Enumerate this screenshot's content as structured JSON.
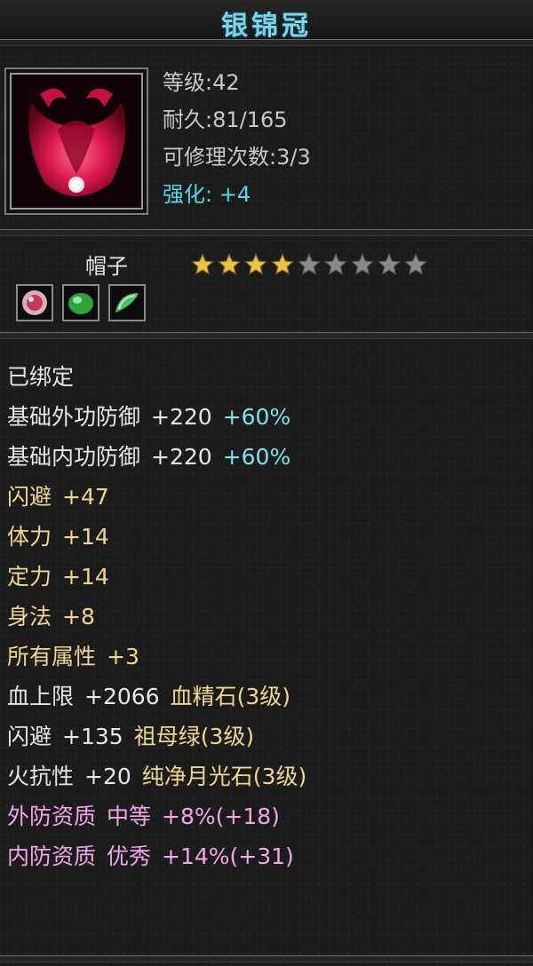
{
  "item": {
    "name": "银锦冠",
    "level": "等级:42",
    "durability": "耐久:81/165",
    "repair_count": "可修理次数:3/3",
    "enhance_label": "强化:",
    "enhance_value": "+4",
    "category": "帽子",
    "stars_filled": 4,
    "stars_total": 9,
    "gems": [
      "blood-essence-gem-icon",
      "emerald-gem-icon",
      "moonstone-gem-icon"
    ]
  },
  "stats": [
    {
      "color": "white",
      "parts": [
        "已绑定"
      ]
    },
    {
      "color": "white",
      "parts": [
        "基础外功防御",
        "+220",
        "+60%"
      ],
      "accent_last": true
    },
    {
      "color": "white",
      "parts": [
        "基础内功防御",
        "+220",
        "+60%"
      ],
      "accent_last": true
    },
    {
      "color": "gold",
      "parts": [
        "闪避",
        "+47"
      ]
    },
    {
      "color": "gold",
      "parts": [
        "体力",
        "+14"
      ]
    },
    {
      "color": "gold",
      "parts": [
        "定力",
        "+14"
      ]
    },
    {
      "color": "gold",
      "parts": [
        "身法",
        "+8"
      ]
    },
    {
      "color": "gold",
      "parts": [
        "所有属性",
        "+3"
      ]
    },
    {
      "color": "white",
      "parts": [
        "血上限",
        "+2066",
        "血精石(3级)"
      ],
      "gold_last": true
    },
    {
      "color": "white",
      "parts": [
        "闪避",
        "+135",
        "祖母绿(3级)"
      ],
      "gold_last": true
    },
    {
      "color": "white",
      "parts": [
        "火抗性",
        "+20",
        "纯净月光石(3级)"
      ],
      "gold_last": true
    },
    {
      "color": "pink",
      "parts": [
        "外防资质",
        "中等",
        "+8%(+18)"
      ]
    },
    {
      "color": "pink",
      "parts": [
        "内防资质",
        "优秀",
        "+14%(+31)"
      ]
    }
  ],
  "colors": {
    "title": "#7fd3e6",
    "white": "#e6e6e6",
    "cyan": "#7fe0ee",
    "gold": "#f0d68e",
    "pink": "#f2a6ea",
    "star_filled": "#e8c24a",
    "star_empty": "#8a8a8a"
  }
}
